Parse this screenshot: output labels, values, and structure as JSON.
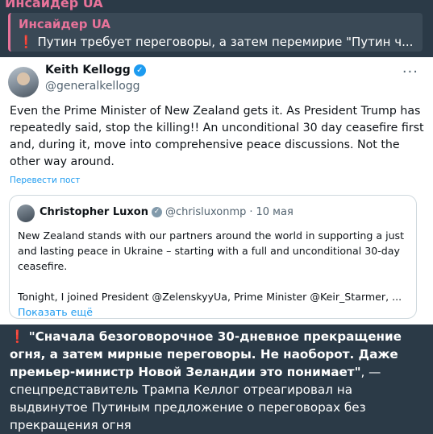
{
  "channel": {
    "name": "Инсайдер UA"
  },
  "reply": {
    "author": "Инсайдер UA",
    "icon": "❗",
    "text": "Путин требует переговоры, а затем перемирие  \"Путин ч..."
  },
  "tweet": {
    "author_name": "Keith Kellogg",
    "author_handle": "@generalkellogg",
    "more": "···",
    "text": "Even the Prime Minister of New Zealand gets it.  As President Trump has repeatedly said, stop the killing!!  An unconditional 30 day ceasefire first and, during it, move into comprehensive peace discussions.  Not the other way around.",
    "translate_label": "Перевести пост",
    "quote": {
      "author_name": "Christopher Luxon",
      "author_handle": "@chrisluxonmp",
      "separator": "·",
      "date": "10 мая",
      "paragraph1": "New Zealand stands with our partners around the world in supporting a just and lasting peace in Ukraine – starting with a full and unconditional 30-day ceasefire.",
      "paragraph2": "Tonight, I joined President @ZelenskyyUa, Prime Minister @Keir_Starmer, ...",
      "show_more": "Показать ещё"
    }
  },
  "message": {
    "icon": "❗",
    "bold_text": "\"Сначала безоговорочное 30-дневное прекращение огня, а затем мирные переговоры. Не наоборот. Даже премьер-министр Новой Зеландии это понимает\"",
    "text": ", — спецпредставитель Трампа Келлог отреагировал на выдвинутое Путиным предложение о переговорах без прекращения огня"
  },
  "colors": {
    "background": "#2b3a47",
    "accent": "#e8739a",
    "link": "#1d9bf0",
    "verified": "#1d9bf0"
  },
  "icons": {
    "verified": "verified-badge-icon",
    "quote_verified": "gray-verified-badge-icon",
    "more": "more-options-icon",
    "alert": "exclamation-icon"
  }
}
